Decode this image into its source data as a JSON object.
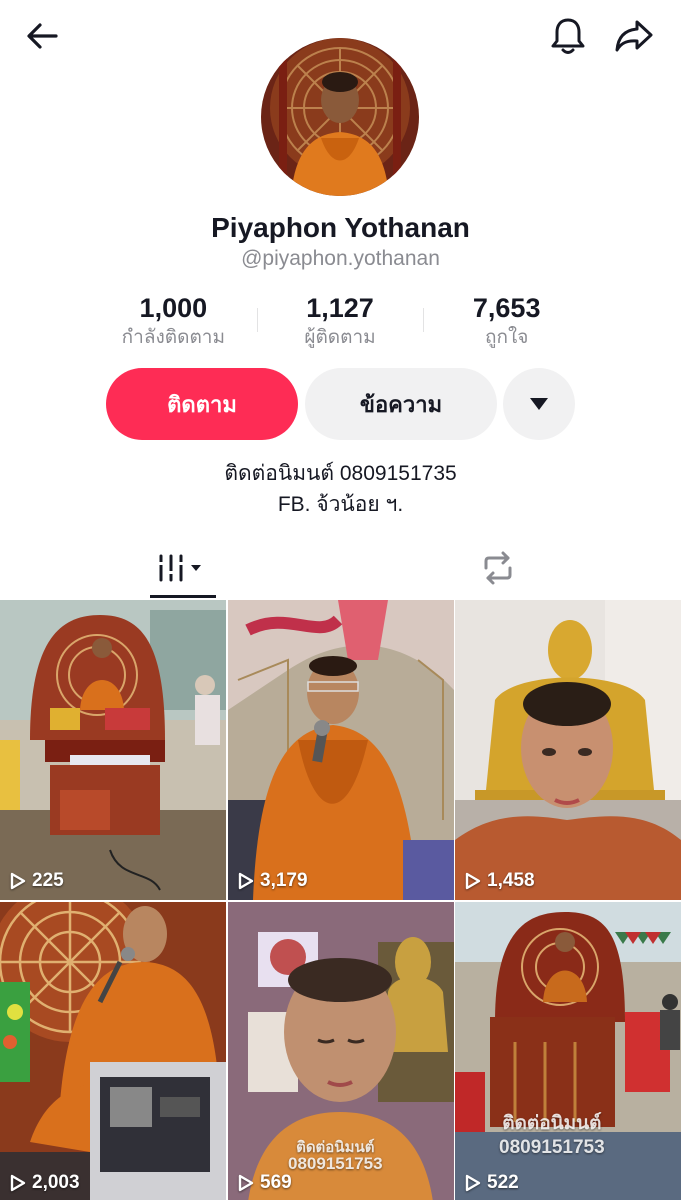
{
  "header": {
    "back_icon": "arrow-left-icon",
    "bell_icon": "bell-icon",
    "share_icon": "share-arrow-icon"
  },
  "profile": {
    "display_name": "Piyaphon Yothanan",
    "username": "@piyaphon.yothanan"
  },
  "stats": [
    {
      "value": "1,000",
      "label": "กำลังติดตาม"
    },
    {
      "value": "1,127",
      "label": "ผู้ติดตาม"
    },
    {
      "value": "7,653",
      "label": "ถูกใจ"
    }
  ],
  "actions": {
    "follow_label": "ติดตาม",
    "message_label": "ข้อความ",
    "more_icon": "caret-down-icon"
  },
  "bio": {
    "line1": "ติดต่อนิมนต์ 0809151735",
    "line2": "FB. จ้วน้อย ฯ."
  },
  "tabs": [
    {
      "icon": "grid-filter-icon",
      "active": true
    },
    {
      "icon": "repost-icon",
      "active": false
    }
  ],
  "videos": [
    {
      "views": "225"
    },
    {
      "views": "3,179"
    },
    {
      "views": "1,458"
    },
    {
      "views": "2,003"
    },
    {
      "views": "569",
      "overlay": [
        "ติดต่อนิมนต์",
        "0809151753"
      ]
    },
    {
      "views": "522",
      "overlay": [
        "ติดต่อนิมนต์",
        "0809151753"
      ]
    }
  ],
  "colors": {
    "accent": "#fe2c55",
    "secondary_button": "#f1f1f2",
    "text_primary": "#161823",
    "text_secondary": "#8a8b91"
  }
}
